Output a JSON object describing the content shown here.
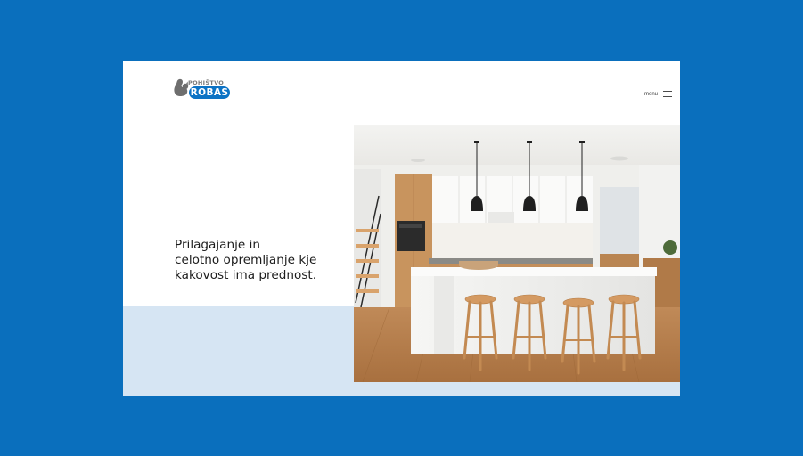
{
  "logo": {
    "top_text": "POHIŠTVO",
    "main_text": "ROBAS"
  },
  "header": {
    "menu_label": "menu"
  },
  "hero": {
    "headline": "Prilagajanje in\ncelotno opremljanje kje\nkakovost ima prednost.",
    "image_alt": "Kitchen interior"
  },
  "colors": {
    "page_background": "#0a6fbd",
    "brand_blue": "#0c73c5",
    "band": "#d6e5f3"
  },
  "icons": [
    "squirrel-logo-icon",
    "hamburger-menu-icon"
  ]
}
